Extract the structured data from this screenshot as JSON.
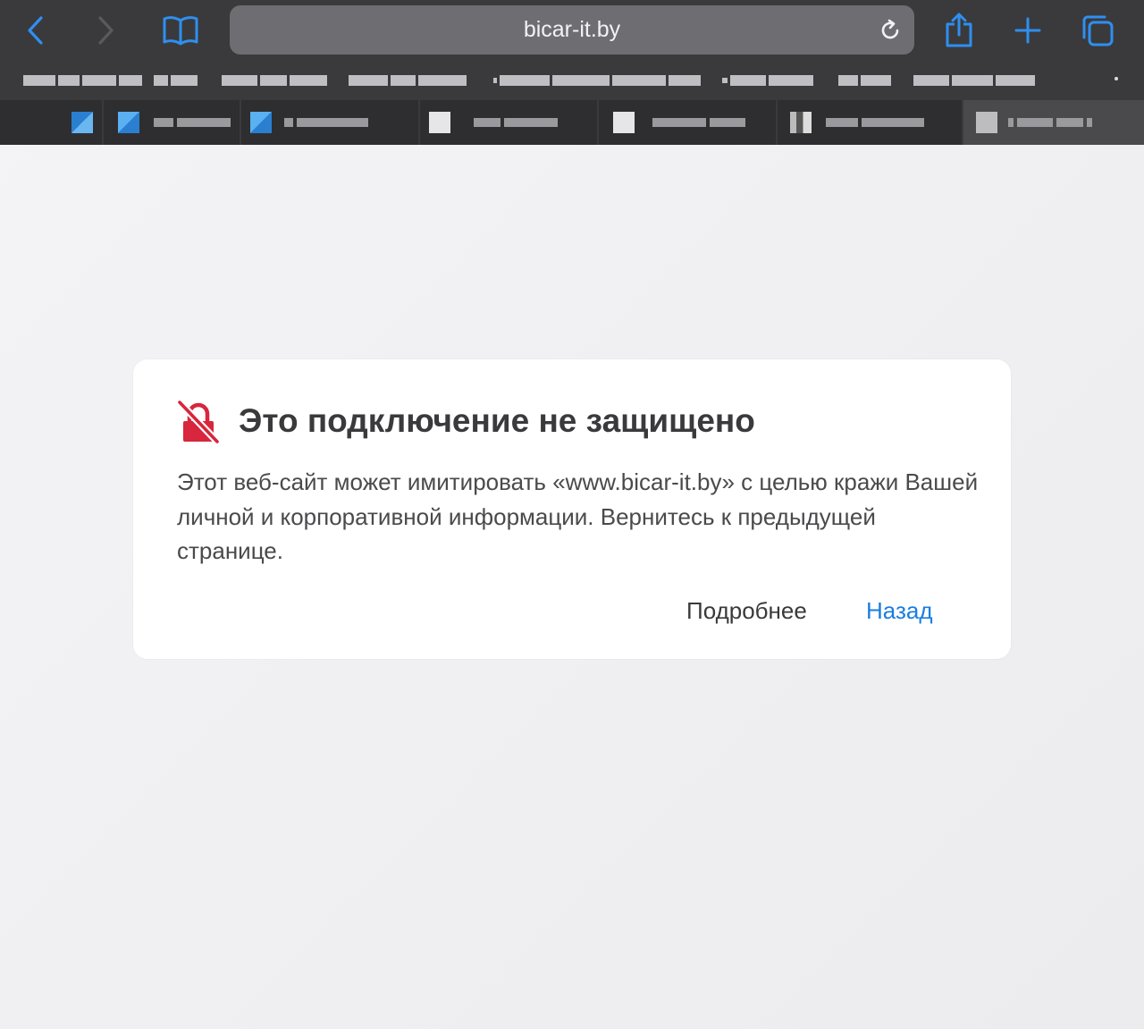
{
  "toolbar": {
    "back_icon": "chevron-left-icon",
    "forward_icon": "chevron-right-icon",
    "bookmarks_icon": "book-icon",
    "url": "bicar-it.by",
    "reload_icon": "reload-icon",
    "share_icon": "share-icon",
    "new_tab_icon": "plus-icon",
    "tabs_icon": "tabs-icon",
    "accent_color": "#2f8ff0"
  },
  "error_card": {
    "icon": "broken-lock-icon",
    "icon_color": "#d7263d",
    "title": "Это подключение не защищено",
    "message": "Этот веб-сайт может имитировать «www.bicar-it.by» с целью кражи Вашей личной и корпоративной информации. Вернитесь к предыдущей странице.",
    "details_label": "Подробнее",
    "back_label": "Назад",
    "back_color": "#1a7ee0"
  }
}
